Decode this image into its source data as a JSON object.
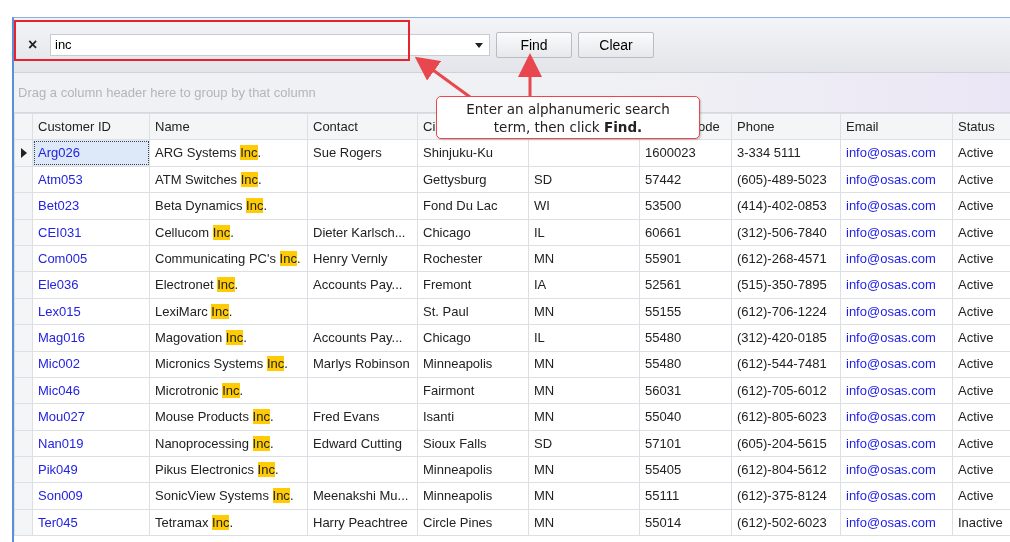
{
  "search": {
    "value": "inc",
    "find_button": "Find",
    "clear_button": "Clear",
    "clear_icon": "×"
  },
  "group_panel": {
    "placeholder": "Drag a column header here to group by that column"
  },
  "table": {
    "columns": [
      {
        "label": "Customer ID",
        "kind": "plain"
      },
      {
        "label": "Name",
        "kind": "plain"
      },
      {
        "label": "Contact",
        "kind": "plain"
      },
      {
        "label": "Ci",
        "kind": "plain"
      },
      {
        "kind": "hidden"
      },
      {
        "label": "ode",
        "kind": "tail"
      },
      {
        "label": "Phone",
        "kind": "plain"
      },
      {
        "label": "Email",
        "kind": "plain"
      },
      {
        "label": "Status",
        "kind": "plain"
      }
    ],
    "rows": [
      {
        "selected": true,
        "id": "Arg026",
        "name": {
          "before": "ARG Systems ",
          "match": "Inc",
          "after": "."
        },
        "contact": "Sue Rogers",
        "city": "Shinjuku-Ku",
        "zip": "1600023",
        "phone": "3-334 5111",
        "email": "info@osas.com",
        "status": "Active"
      },
      {
        "selected": false,
        "id": "Atm053",
        "name": {
          "before": "ATM Switches ",
          "match": "Inc",
          "after": "."
        },
        "city": "Gettysburg",
        "state": "SD",
        "zip": "57442",
        "phone": "(605)-489-5023",
        "email": "info@osas.com",
        "status": "Active"
      },
      {
        "selected": false,
        "id": "Bet023",
        "name": {
          "before": "Beta Dynamics ",
          "match": "Inc",
          "after": "."
        },
        "city": "Fond Du Lac",
        "state": "WI",
        "zip": "53500",
        "phone": "(414)-402-0853",
        "email": "info@osas.com",
        "status": "Active"
      },
      {
        "selected": false,
        "id": "CEI031",
        "name": {
          "before": "Cellucom ",
          "match": "Inc",
          "after": "."
        },
        "contact": "Dieter Karlsch...",
        "city": "Chicago",
        "state": "IL",
        "zip": "60661",
        "phone": "(312)-506-7840",
        "email": "info@osas.com",
        "status": "Active"
      },
      {
        "selected": false,
        "id": "Com005",
        "name": {
          "before": "Communicating PC's ",
          "match": "Inc",
          "after": "."
        },
        "contact": "Henry Vernly",
        "city": "Rochester",
        "state": "MN",
        "zip": "55901",
        "phone": "(612)-268-4571",
        "email": "info@osas.com",
        "status": "Active"
      },
      {
        "selected": false,
        "id": "Ele036",
        "name": {
          "before": "Electronet ",
          "match": "Inc",
          "after": "."
        },
        "contact": "Accounts Pay...",
        "city": "Fremont",
        "state": "IA",
        "zip": "52561",
        "phone": "(515)-350-7895",
        "email": "info@osas.com",
        "status": "Active"
      },
      {
        "selected": false,
        "id": "Lex015",
        "name": {
          "before": "LexiMarc ",
          "match": "Inc",
          "after": "."
        },
        "city": "St. Paul",
        "state": "MN",
        "zip": "55155",
        "phone": "(612)-706-1224",
        "email": "info@osas.com",
        "status": "Active"
      },
      {
        "selected": false,
        "id": "Mag016",
        "name": {
          "before": "Magovation ",
          "match": "Inc",
          "after": "."
        },
        "contact": "Accounts Pay...",
        "city": "Chicago",
        "state": "IL",
        "zip": "55480",
        "phone": "(312)-420-0185",
        "email": "info@osas.com",
        "status": "Active"
      },
      {
        "selected": false,
        "id": "Mic002",
        "name": {
          "before": "Micronics Systems ",
          "match": "Inc",
          "after": "."
        },
        "contact": "Marlys Robinson",
        "city": "Minneapolis",
        "state": "MN",
        "zip": "55480",
        "phone": "(612)-544-7481",
        "email": "info@osas.com",
        "status": "Active"
      },
      {
        "selected": false,
        "id": "Mic046",
        "name": {
          "before": "Microtronic ",
          "match": "Inc",
          "after": "."
        },
        "city": "Fairmont",
        "state": "MN",
        "zip": "56031",
        "phone": "(612)-705-6012",
        "email": "info@osas.com",
        "status": "Active"
      },
      {
        "selected": false,
        "id": "Mou027",
        "name": {
          "before": "Mouse Products ",
          "match": "Inc",
          "after": "."
        },
        "contact": "Fred Evans",
        "city": "Isanti",
        "state": "MN",
        "zip": "55040",
        "phone": "(612)-805-6023",
        "email": "info@osas.com",
        "status": "Active"
      },
      {
        "selected": false,
        "id": "Nan019",
        "name": {
          "before": "Nanoprocessing ",
          "match": "Inc",
          "after": "."
        },
        "contact": "Edward Cutting",
        "city": "Sioux Falls",
        "state": "SD",
        "zip": "57101",
        "phone": "(605)-204-5615",
        "email": "info@osas.com",
        "status": "Active"
      },
      {
        "selected": false,
        "id": "Pik049",
        "name": {
          "before": "Pikus Electronics ",
          "match": "Inc",
          "after": "."
        },
        "city": "Minneapolis",
        "state": "MN",
        "zip": "55405",
        "phone": "(612)-804-5612",
        "email": "info@osas.com",
        "status": "Active"
      },
      {
        "selected": false,
        "id": "Son009",
        "name": {
          "before": "SonicView Systems ",
          "match": "Inc",
          "after": "."
        },
        "contact": "Meenakshi Mu...",
        "city": "Minneapolis",
        "state": "MN",
        "zip": "55111",
        "phone": "(612)-375-8124",
        "email": "info@osas.com",
        "status": "Active"
      },
      {
        "selected": false,
        "id": "Ter045",
        "name": {
          "before": "Tetramax ",
          "match": "Inc",
          "after": "."
        },
        "contact": "Harry Peachtree",
        "city": "Circle Pines",
        "state": "MN",
        "zip": "55014",
        "phone": "(612)-502-6023",
        "email": "info@osas.com",
        "status": "Inactive"
      }
    ]
  },
  "callout": {
    "text": "Enter an alphanumeric search term, then click **Find.**"
  }
}
